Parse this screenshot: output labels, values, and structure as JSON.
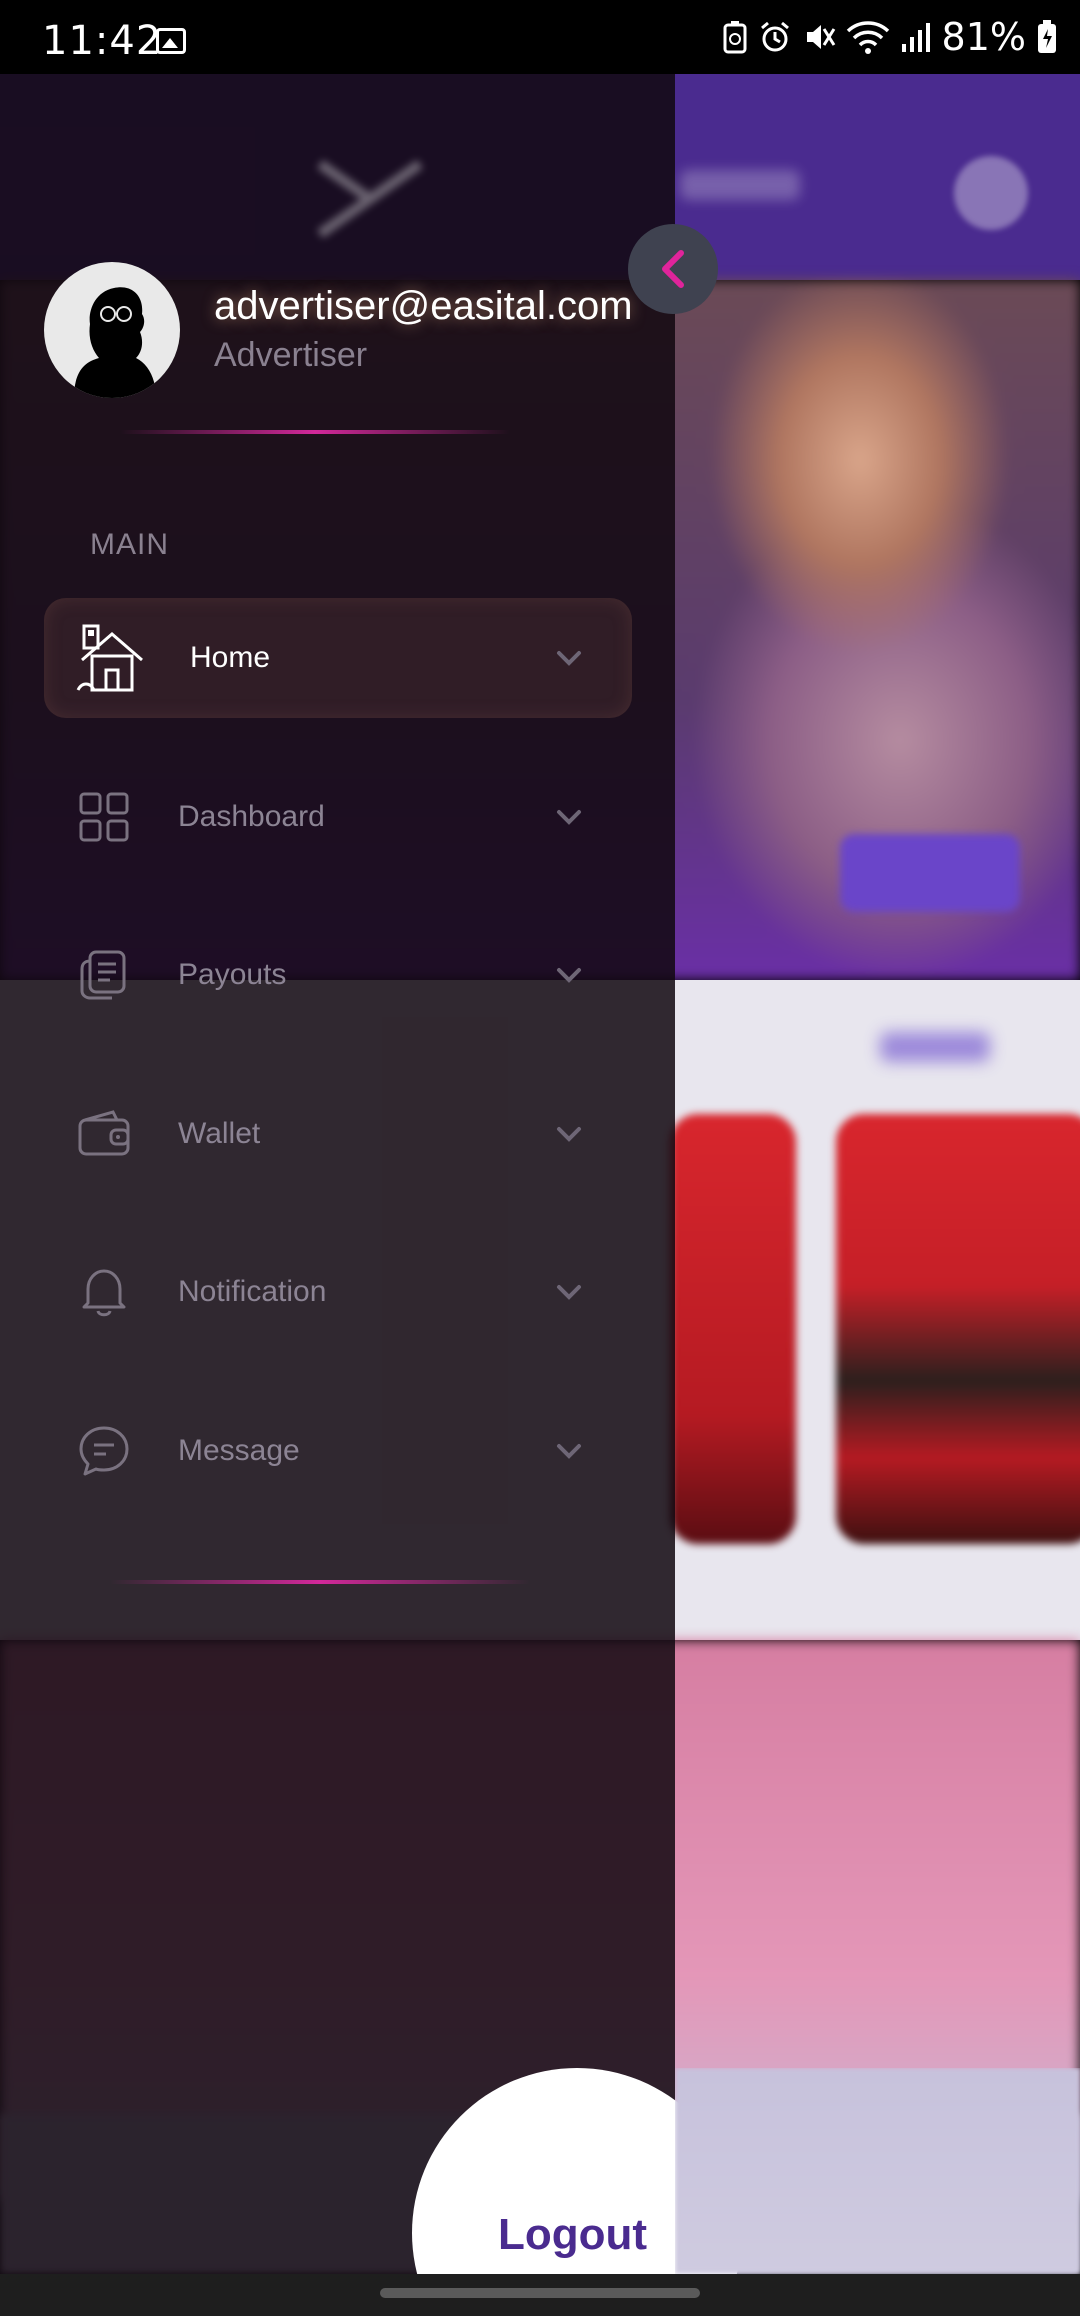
{
  "status_bar": {
    "time": "11:42",
    "battery_percent": "81%"
  },
  "drawer": {
    "profile": {
      "email": "advertiser@easital.com",
      "role": "Advertiser"
    },
    "section_label": "MAIN",
    "menu": [
      {
        "label": "Home",
        "icon": "house-icon",
        "active": true
      },
      {
        "label": "Dashboard",
        "icon": "grid-icon",
        "active": false
      },
      {
        "label": "Payouts",
        "icon": "document-icon",
        "active": false
      },
      {
        "label": "Wallet",
        "icon": "wallet-icon",
        "active": false
      },
      {
        "label": "Notification",
        "icon": "bell-icon",
        "active": false
      },
      {
        "label": "Message",
        "icon": "chat-bubble-icon",
        "active": false
      }
    ],
    "logout_label": "Logout"
  },
  "colors": {
    "accent_pink": "#e0249b",
    "brand_purple": "#4a2b8f",
    "drawer_bg": "#120810"
  }
}
